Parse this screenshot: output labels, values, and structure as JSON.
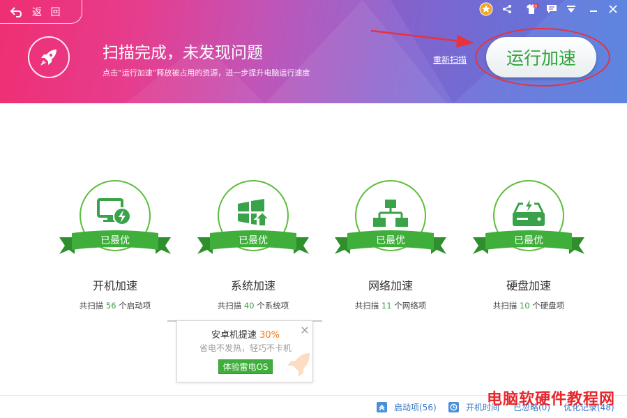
{
  "header": {
    "back_label": "返 回",
    "title": "扫描完成，未发现问题",
    "subtitle": "点击“运行加速”释放被占用的资源，进一步提升电脑运行速度",
    "rescan_label": "重新扫描",
    "run_button_label": "运行加速",
    "toolbar_icons": [
      "star-badge-icon",
      "share-icon",
      "shirt-skin-icon",
      "message-icon",
      "dropdown-menu-icon",
      "minimize-icon",
      "close-icon"
    ]
  },
  "cards": [
    {
      "icon": "monitor-lightning-icon",
      "badge": "已最优",
      "name": "开机加速",
      "stat_prefix": "共扫描",
      "count": "56",
      "stat_suffix": "个启动项"
    },
    {
      "icon": "windows-upgrade-icon",
      "badge": "已最优",
      "name": "系统加速",
      "stat_prefix": "共扫描",
      "count": "40",
      "stat_suffix": "个系统项"
    },
    {
      "icon": "network-topology-icon",
      "badge": "已最优",
      "name": "网络加速",
      "stat_prefix": "共扫描",
      "count": "11",
      "stat_suffix": "个网络项"
    },
    {
      "icon": "hard-disk-icon",
      "badge": "已最优",
      "name": "硬盘加速",
      "stat_prefix": "共扫描",
      "count": "10",
      "stat_suffix": "个硬盘项"
    }
  ],
  "popup": {
    "title": "安卓机提速",
    "percent": "30%",
    "subtitle": "省电不发热，轻巧不卡机",
    "button_label": "体验雷电OS"
  },
  "footer": {
    "items": [
      {
        "icon": "startup-items-icon",
        "label": "启动项(56)"
      },
      {
        "icon": "clock-icon",
        "label": "开机时间"
      },
      {
        "icon": "disabled-icon",
        "label": "已忽略(0)"
      },
      {
        "icon": "history-icon",
        "label": "优化记录(48)"
      }
    ]
  },
  "watermark": "电脑软硬件教程网",
  "colors": {
    "accent_green": "#3fae3b",
    "ring_green": "#5cbd3c",
    "highlight_red": "#e8323c",
    "percent_orange": "#f07b1d",
    "link_blue": "#3a78c4"
  }
}
